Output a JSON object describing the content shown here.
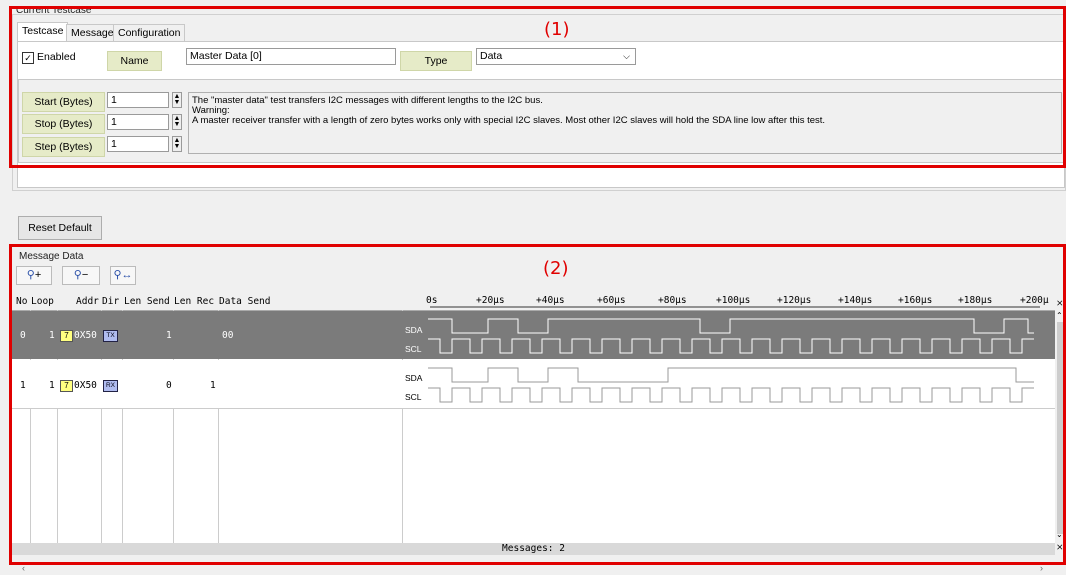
{
  "current_testcase": {
    "group_title": "Current Testcase",
    "tabs": [
      "Testcase",
      "Message",
      "Configuration"
    ],
    "enabled_label": "Enabled",
    "enabled_checked": true,
    "name_label": "Name",
    "name_value": "Master Data [0]",
    "type_label": "Type",
    "type_value": "Data",
    "start_label": "Start (Bytes)",
    "start_value": "1",
    "stop_label": "Stop (Bytes)",
    "stop_value": "1",
    "step_label": "Step (Bytes)",
    "step_value": "1",
    "description_line1": "The \"master data\" test transfers I2C messages with different lengths to the I2C bus.",
    "description_line2": "Warning:",
    "description_line3": "A master receiver transfer with a length of zero bytes works only with special I2C slaves. Most other I2C slaves will hold the SDA line low after this test.",
    "reset_label": "Reset Default"
  },
  "annotations": {
    "one": "(1)",
    "two": "(2)"
  },
  "message_data": {
    "group_title": "Message Data",
    "zoom_in_label": "+",
    "zoom_out_label": "−",
    "columns": [
      "No",
      "Loop",
      "Addr",
      "Dir",
      "Len Send",
      "Len Rec",
      "Data Send"
    ],
    "timeline_ticks": [
      "0s",
      "+20µs",
      "+40µs",
      "+60µs",
      "+80µs",
      "+100µs",
      "+120µs",
      "+140µs",
      "+160µs",
      "+180µs",
      "+200µ"
    ],
    "rows": [
      {
        "no": "0",
        "loop": "1",
        "badge": "7",
        "addr": "0X50",
        "dir": "TX",
        "len_send": "1",
        "len_rec": "",
        "data_send": "00",
        "sda": "SDA",
        "scl": "SCL"
      },
      {
        "no": "1",
        "loop": "1",
        "badge": "7",
        "addr": "0X50",
        "dir": "RX",
        "len_send": "0",
        "len_rec": "1",
        "data_send": "",
        "sda": "SDA",
        "scl": "SCL"
      }
    ],
    "status": "Messages: 2"
  }
}
